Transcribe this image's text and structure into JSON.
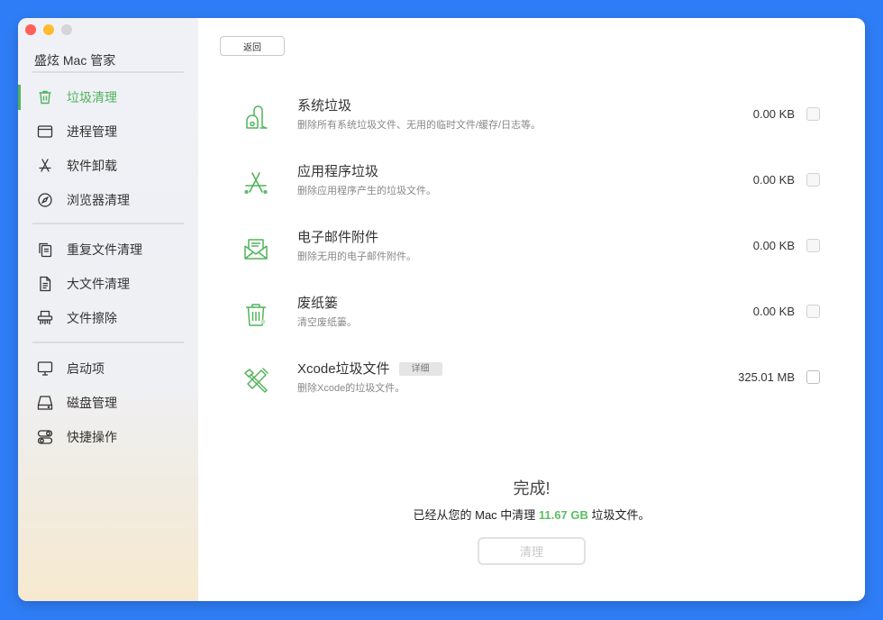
{
  "app": {
    "title": "盛炫 Mac 管家"
  },
  "sidebar": {
    "groups": [
      [
        {
          "label": "垃圾清理",
          "icon": "trash-icon",
          "active": true
        },
        {
          "label": "进程管理",
          "icon": "window-icon"
        },
        {
          "label": "软件卸载",
          "icon": "app-store-icon"
        },
        {
          "label": "浏览器清理",
          "icon": "compass-icon"
        }
      ],
      [
        {
          "label": "重复文件清理",
          "icon": "duplicate-files-icon"
        },
        {
          "label": "大文件清理",
          "icon": "document-icon"
        },
        {
          "label": "文件擦除",
          "icon": "shredder-icon"
        }
      ],
      [
        {
          "label": "启动项",
          "icon": "monitor-icon"
        },
        {
          "label": "磁盘管理",
          "icon": "disk-icon"
        },
        {
          "label": "快捷操作",
          "icon": "toggles-icon"
        }
      ]
    ]
  },
  "toolbar": {
    "back_label": "返回"
  },
  "items": [
    {
      "title": "系统垃圾",
      "desc": "删除所有系统垃圾文件、无用的临时文件/缓存/日志等。",
      "size": "0.00 KB",
      "icon": "vacuum-icon"
    },
    {
      "title": "应用程序垃圾",
      "desc": "删除应用程序产生的垃圾文件。",
      "size": "0.00 KB",
      "icon": "app-store-icon"
    },
    {
      "title": "电子邮件附件",
      "desc": "删除无用的电子邮件附件。",
      "size": "0.00 KB",
      "icon": "mail-icon"
    },
    {
      "title": "废纸篓",
      "desc": "清空废纸篓。",
      "size": "0.00 KB",
      "icon": "trash-bin-icon"
    },
    {
      "title": "Xcode垃圾文件",
      "desc": "删除Xcode的垃圾文件。",
      "size": "325.01 MB",
      "icon": "hammer-icon",
      "badge": "详细"
    }
  ],
  "summary": {
    "title": "完成!",
    "prefix": "已经从您的 Mac 中清理 ",
    "amount": "11.67 GB",
    "suffix": " 垃圾文件。",
    "button_label": "清理"
  },
  "colors": {
    "accent": "#52b35c",
    "background": "#2f7df6"
  }
}
